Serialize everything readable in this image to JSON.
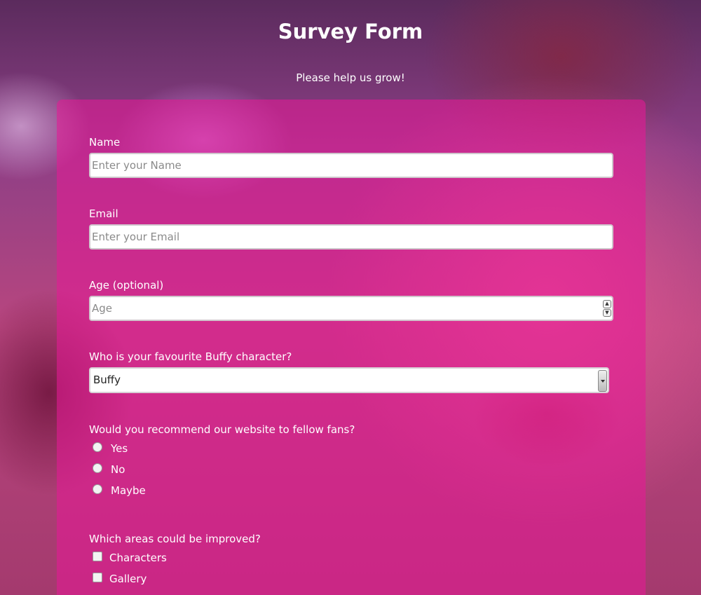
{
  "header": {
    "title": "Survey Form",
    "description": "Please help us grow!"
  },
  "form": {
    "name": {
      "label": "Name",
      "placeholder": "Enter your Name",
      "value": ""
    },
    "email": {
      "label": "Email",
      "placeholder": "Enter your Email",
      "value": ""
    },
    "age": {
      "label": "Age (optional)",
      "placeholder": "Age",
      "value": ""
    },
    "character": {
      "label": "Who is your favourite Buffy character?",
      "selected": "Buffy"
    },
    "recommend": {
      "label": "Would you recommend our website to fellow fans?",
      "options": [
        "Yes",
        "No",
        "Maybe"
      ]
    },
    "improve": {
      "label": "Which areas could be improved?",
      "options": [
        "Characters",
        "Gallery"
      ]
    }
  },
  "colors": {
    "panel": "#e61996",
    "text": "#ffffff"
  },
  "icons": {
    "select_arrow": "chevron-down-icon",
    "spinner": "spinner-arrows-icon"
  }
}
